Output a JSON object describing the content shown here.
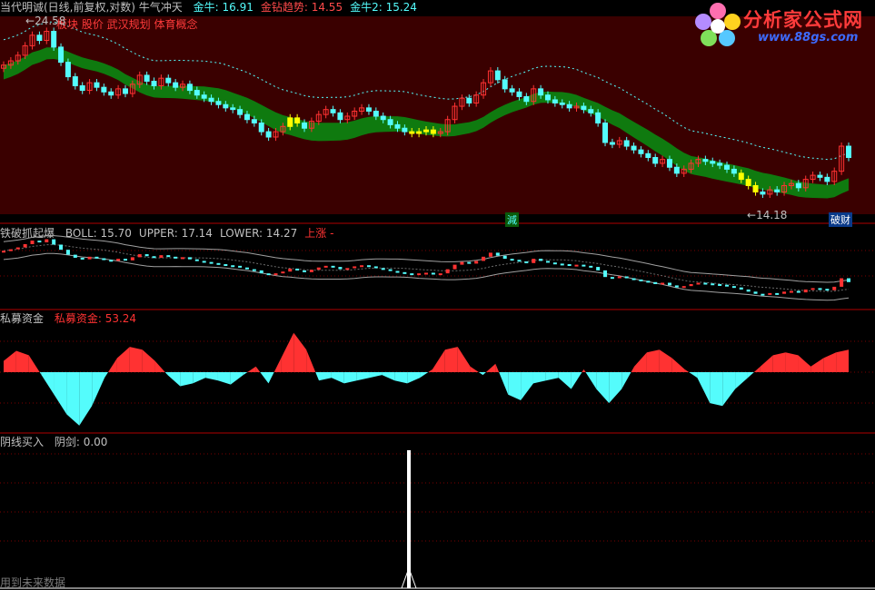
{
  "colors": {
    "up": "#ff3232",
    "down": "#54fcfc",
    "green_band": "#0f7a0f",
    "yellow": "#ffff00",
    "grid": "#8b0000",
    "panel_border": "#b00000",
    "bg_top": "#3a0000",
    "bull_cyan": "#54fcfc",
    "gold_drill": "#ff4a4a",
    "bull2": "#54fcfc"
  },
  "panel1": {
    "header": {
      "title": "当代明诚(日线,前复权,对数) 牛气冲天",
      "items": [
        {
          "label": "金牛:",
          "value": "16.91",
          "color": "#54fcfc"
        },
        {
          "label": "金钻趋势:",
          "value": "14.55",
          "color": "#ff4a4a"
        },
        {
          "label": "金牛2:",
          "value": "15.24",
          "color": "#54fcfc"
        }
      ]
    },
    "sub_header": "股价 武汉规划 体育概念",
    "sub_header_prefix": "板块",
    "price_marker_high": "24.58",
    "price_marker_low": "14.18",
    "marker_jian": "減",
    "marker_bi": "破财"
  },
  "panel2": {
    "header": {
      "title": "铁破抓起爆",
      "items": [
        {
          "label": "BOLL:",
          "value": "15.70",
          "color": "#c0c0c0"
        },
        {
          "label": "UPPER:",
          "value": "17.14",
          "color": "#c0c0c0"
        },
        {
          "label": "LOWER:",
          "value": "14.27",
          "color": "#c0c0c0"
        },
        {
          "label": "上涨",
          "value": "-",
          "color": "#ff3232"
        }
      ]
    }
  },
  "panel3": {
    "header": {
      "title": "私募资金",
      "items": [
        {
          "label": "私募资金:",
          "value": "53.24",
          "color": "#ff3232"
        }
      ]
    }
  },
  "panel4": {
    "header": {
      "title": "阴线买入",
      "items": [
        {
          "label": "阴剑:",
          "value": "0.00",
          "color": "#c0c0c0"
        }
      ]
    },
    "footer_note": "用到未来数据"
  },
  "logo": {
    "title": "分析家公式网",
    "url": "www.88gs.com"
  },
  "chart_data": [
    {
      "type": "candlestick",
      "title": "当代明诚(日线,前复权,对数)",
      "scale": "log",
      "ylim": [
        13.5,
        25.5
      ],
      "notes": "Prices estimated from screen; labeled high 24.58 and low 14.18",
      "close": [
        21.8,
        22.1,
        22.5,
        23.2,
        24.0,
        23.6,
        24.3,
        23.1,
        22.0,
        21.0,
        20.4,
        20.1,
        20.6,
        20.3,
        20.0,
        19.8,
        20.2,
        19.9,
        20.5,
        21.1,
        20.7,
        20.4,
        20.9,
        20.6,
        20.3,
        20.5,
        20.1,
        19.8,
        19.6,
        19.4,
        19.2,
        19.0,
        18.9,
        18.6,
        18.3,
        18.1,
        17.6,
        17.3,
        17.6,
        17.9,
        18.4,
        18.1,
        17.8,
        18.2,
        18.6,
        18.9,
        18.7,
        18.3,
        18.5,
        18.8,
        19.0,
        18.8,
        18.5,
        18.3,
        18.0,
        17.8,
        17.6,
        17.5,
        17.6,
        17.7,
        17.5,
        17.6,
        18.3,
        19.1,
        19.6,
        19.3,
        19.8,
        20.6,
        21.4,
        20.8,
        20.2,
        20.0,
        19.7,
        19.4,
        20.2,
        19.8,
        19.5,
        19.3,
        19.2,
        19.0,
        19.1,
        18.9,
        18.7,
        18.1,
        17.0,
        16.9,
        17.1,
        16.8,
        16.6,
        16.4,
        16.2,
        15.9,
        16.1,
        15.7,
        15.4,
        15.6,
        15.9,
        16.1,
        16.0,
        15.9,
        15.8,
        15.6,
        15.4,
        15.1,
        14.8,
        14.5,
        14.4,
        14.6,
        14.5,
        14.8,
        14.9,
        14.7,
        15.1,
        15.3,
        15.2,
        15.0,
        15.5,
        16.8,
        16.2
      ],
      "indicator_lines": [
        {
          "name": "金牛",
          "last": 16.91
        },
        {
          "name": "金钻趋势",
          "last": 14.55
        },
        {
          "name": "金牛2",
          "last": 15.24
        }
      ]
    },
    {
      "type": "line",
      "title": "铁破抓起爆",
      "series": [
        {
          "name": "BOLL",
          "last": 15.7
        },
        {
          "name": "UPPER",
          "last": 17.14
        },
        {
          "name": "LOWER",
          "last": 14.27
        }
      ]
    },
    {
      "type": "area",
      "title": "私募资金",
      "series": [
        {
          "name": "私募资金",
          "last": 53.24,
          "values": [
            20,
            38,
            30,
            -5,
            -40,
            -75,
            -95,
            -60,
            -10,
            25,
            45,
            40,
            20,
            -5,
            -25,
            -20,
            -10,
            -15,
            -22,
            -5,
            10,
            -20,
            25,
            70,
            40,
            -15,
            -10,
            -20,
            -15,
            -10,
            -5,
            -15,
            -20,
            -10,
            5,
            40,
            45,
            10,
            -5,
            15,
            -40,
            -50,
            -20,
            -15,
            -10,
            -30,
            5,
            -30,
            -55,
            -30,
            10,
            35,
            40,
            25,
            5,
            -10,
            -55,
            -60,
            -30,
            -10,
            10,
            30,
            35,
            30,
            10,
            25,
            35,
            40
          ]
        }
      ]
    },
    {
      "type": "bar",
      "title": "阴线买入",
      "series": [
        {
          "name": "阴剑",
          "last": 0.0,
          "spike_index": 58,
          "spike_value": 1
        }
      ]
    }
  ]
}
